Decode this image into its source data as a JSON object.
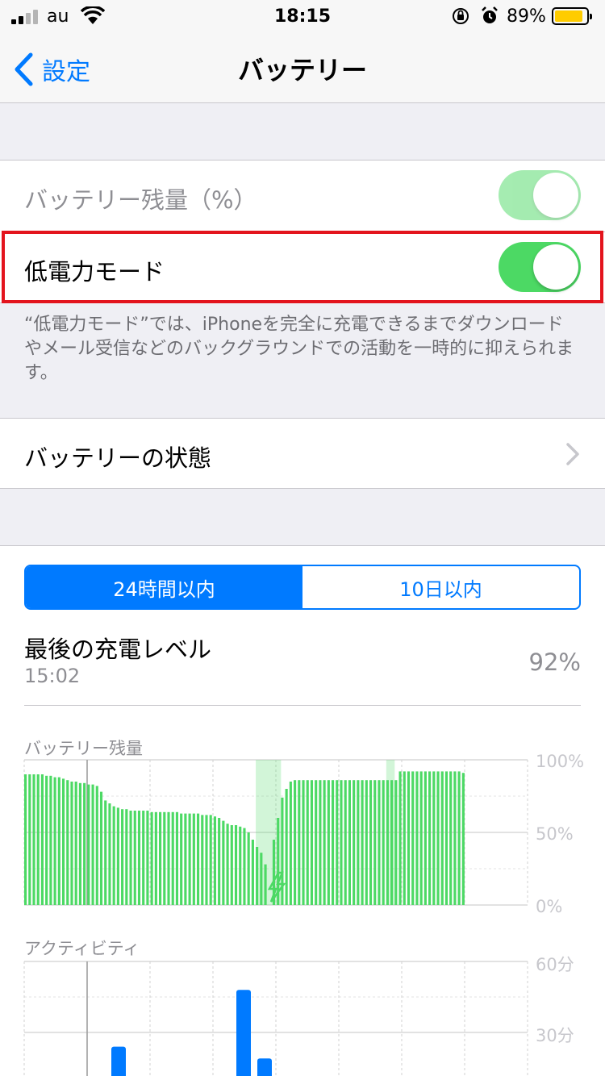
{
  "status_bar": {
    "carrier": "au",
    "time": "18:15",
    "battery_percent": "89%",
    "battery_level": 0.89,
    "icons": [
      "signal-icon",
      "wifi-icon",
      "orientation-lock-icon",
      "alarm-icon",
      "battery-icon"
    ]
  },
  "nav": {
    "back_label": "設定",
    "title": "バッテリー"
  },
  "settings": {
    "battery_percentage": {
      "label": "バッテリー残量（%）",
      "on": true,
      "disabled": true
    },
    "low_power_mode": {
      "label": "低電力モード",
      "on": true
    },
    "footnote": "“低電力モード”では、iPhoneを完全に充電できるまでダウンロードやメール受信などのバックグラウンドでの活動を一時的に抑えられます。",
    "battery_health": {
      "label": "バッテリーの状態"
    }
  },
  "usage": {
    "segments": [
      "24時間以内",
      "10日以内"
    ],
    "active_segment": 0,
    "last_charge_title": "最後の充電レベル",
    "last_charge_time": "15:02",
    "last_charge_level": "92%"
  },
  "colors": {
    "accent": "#007aff",
    "toggle_on": "#4cd964",
    "battery_bar": "#4cd964",
    "activity_bar": "#007aff",
    "highlight_border": "#e3141d",
    "battery_fill": "#ffcc00"
  },
  "chart_data": [
    {
      "type": "bar",
      "title": "バッテリー残量",
      "ylim": [
        0,
        100
      ],
      "ytick_labels": [
        "100%",
        "50%",
        "0%"
      ],
      "grid": true,
      "values": [
        90,
        90,
        90,
        90,
        90,
        89,
        89,
        88,
        88,
        87,
        86,
        85,
        85,
        84,
        84,
        83,
        83,
        82,
        78,
        72,
        70,
        68,
        67,
        66,
        66,
        65,
        65,
        65,
        65,
        65,
        64,
        64,
        64,
        64,
        64,
        64,
        64,
        63,
        63,
        63,
        63,
        63,
        62,
        62,
        62,
        61,
        60,
        58,
        56,
        55,
        55,
        54,
        53,
        50,
        45,
        40,
        36,
        28,
        0,
        45,
        60,
        74,
        80,
        85,
        86,
        86,
        86,
        86,
        86,
        86,
        86,
        86,
        86,
        86,
        86,
        86,
        86,
        86,
        86,
        86,
        86,
        86,
        86,
        86,
        86,
        86,
        86,
        86,
        86,
        92,
        92,
        92,
        92,
        92,
        92,
        92,
        92,
        92,
        92,
        92,
        92,
        92,
        92,
        92,
        91
      ],
      "charging_spans": [
        [
          55,
          61
        ],
        [
          86,
          88
        ]
      ]
    },
    {
      "type": "bar",
      "title": "アクティビティ",
      "ytick_labels": [
        "60分",
        "30分"
      ],
      "ylim": [
        0,
        60
      ],
      "grid": true,
      "categories": [
        "bar1",
        "bar2",
        "bar3"
      ],
      "values": [
        24,
        48,
        19
      ]
    }
  ]
}
